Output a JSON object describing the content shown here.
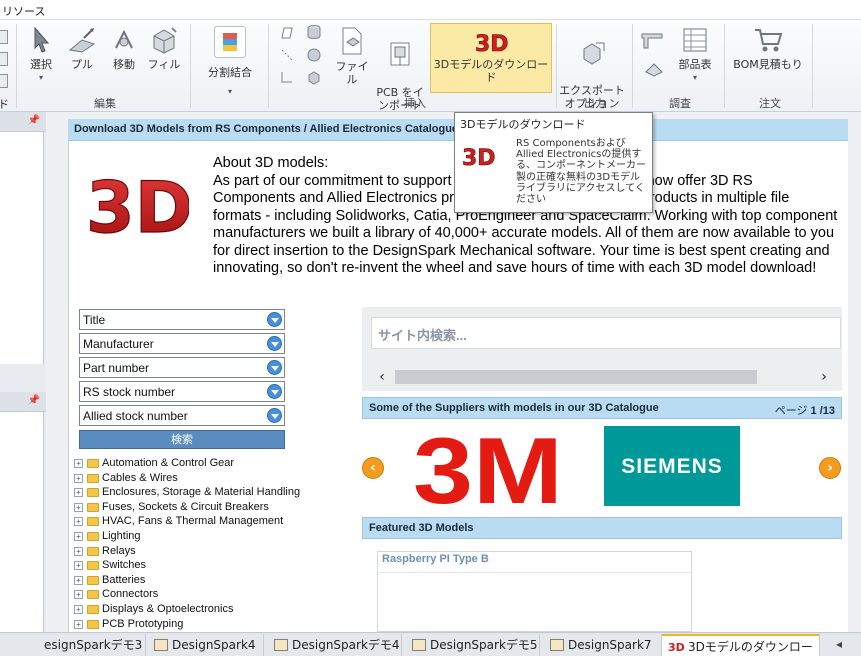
{
  "title_strip": "リソース",
  "ribbon": {
    "edit_buttons": [
      {
        "label": "選択",
        "icon": "cursor-icon"
      },
      {
        "label": "プル",
        "icon": "pull-icon"
      },
      {
        "label": "移動",
        "icon": "move-icon"
      },
      {
        "label": "フィル",
        "icon": "fill-icon"
      }
    ],
    "split_merge": "分割結合",
    "file": "ファイル",
    "pcb_import": "PCB をイ\nンポート",
    "download_3d": "3Dモデルのダウンロード",
    "export_option": "エクスポート\nオプション",
    "parts_table": "部品表",
    "bom_quote": "BOM見積もり",
    "groups": {
      "edit": "編集",
      "insert": "挿入",
      "output": "出力",
      "survey": "調査",
      "order": "注文"
    },
    "left_clipped_label": "ド"
  },
  "page": {
    "header": "Download 3D Models from RS Components / Allied Electronics Catalogue",
    "about_text": "About 3D models:\nAs part of our commitment to support DesignSpark Mechanical, we now offer 3D RS Components and Allied Electronics provide 3D CAD Models of our products in multiple file formats - including Solidworks, Catia, ProEngineer and SpaceClaim. Working with top component manufacturers we built a library of 40,000+ accurate models. All of them are now available to you for direct insertion to the DesignSpark Mechanical software. Your time is best spent creating and innovating, so don't re-invent the wheel and save hours of time with each 3D model download!",
    "logo_text": "3D",
    "fields": [
      "Title",
      "Manufacturer",
      "Part number",
      "RS stock number",
      "Allied stock number"
    ],
    "search_button": "検索",
    "categories": [
      "Automation & Control Gear",
      "Cables & Wires",
      "Enclosures, Storage & Material Handling",
      "Fuses, Sockets & Circuit Breakers",
      "HVAC, Fans & Thermal Management",
      "Lighting",
      "Relays",
      "Switches",
      "Batteries",
      "Connectors",
      "Displays & Optoelectronics",
      "PCB Prototyping"
    ],
    "site_search_placeholder": "サイト内検索...",
    "suppliers_title": "Some of the Suppliers with models in our 3D Catalogue",
    "suppliers_page_prefix": "ページ",
    "suppliers_page": "1 /13",
    "supplier_logos": [
      "3M",
      "SIEMENS"
    ],
    "featured_title": "Featured 3D Models",
    "featured_item": "Raspberry PI Type B"
  },
  "tooltip": {
    "title": "3Dモデルのダウンロード",
    "body": "RS Componentsおよび Allied Electronicsの提供する、コンポーネントメーカー製の正確な無料の3Dモデルライブラリにアクセスしてください"
  },
  "tabs": [
    {
      "label": "esignSparkデモ3"
    },
    {
      "label": "DesignSpark4"
    },
    {
      "label": "DesignSparkデモ4"
    },
    {
      "label": "DesignSparkデモ5"
    },
    {
      "label": "DesignSpark7"
    },
    {
      "label": "3Dモデルのダウンロード",
      "active": true
    }
  ],
  "colors": {
    "blue_header": "#b9dcf2",
    "logo_red": "#cc1f1f",
    "siemens_teal": "#009999",
    "arrow_orange": "#f39c1f",
    "ribbon_highlight": "#fbe9a6"
  }
}
